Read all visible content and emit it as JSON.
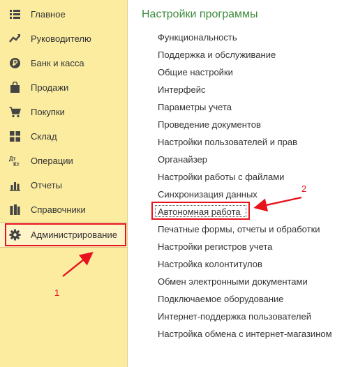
{
  "sidebar": {
    "items": [
      {
        "label": "Главное",
        "icon": "menu-lines-icon"
      },
      {
        "label": "Руководителю",
        "icon": "trend-chart-icon"
      },
      {
        "label": "Банк и касса",
        "icon": "ruble-coin-icon"
      },
      {
        "label": "Продажи",
        "icon": "shopping-bag-icon"
      },
      {
        "label": "Покупки",
        "icon": "shopping-cart-icon"
      },
      {
        "label": "Склад",
        "icon": "warehouse-grid-icon"
      },
      {
        "label": "Операции",
        "icon": "debit-credit-icon"
      },
      {
        "label": "Отчеты",
        "icon": "bar-chart-icon"
      },
      {
        "label": "Справочники",
        "icon": "books-icon"
      },
      {
        "label": "Администрирование",
        "icon": "gear-icon"
      }
    ],
    "active_index": 9
  },
  "main": {
    "title": "Настройки программы",
    "links": [
      "Функциональность",
      "Поддержка и обслуживание",
      "Общие настройки",
      "Интерфейс",
      "Параметры учета",
      "Проведение документов",
      "Настройки пользователей и прав",
      "Органайзер",
      "Настройки работы с файлами",
      "Синхронизация данных",
      "Автономная работа",
      "Печатные формы, отчеты и обработки",
      "Настройки регистров учета",
      "Настройка колонтитулов",
      "Обмен электронными документами",
      "Подключаемое оборудование",
      "Интернет-поддержка пользователей",
      "Настройка обмена с интернет-магазином"
    ],
    "highlighted_index": 10
  },
  "annotations": {
    "step1": "1",
    "step2": "2"
  },
  "colors": {
    "sidebar_bg": "#fbeca0",
    "title_green": "#3c8a3c",
    "annotation_red": "#e8121c"
  }
}
